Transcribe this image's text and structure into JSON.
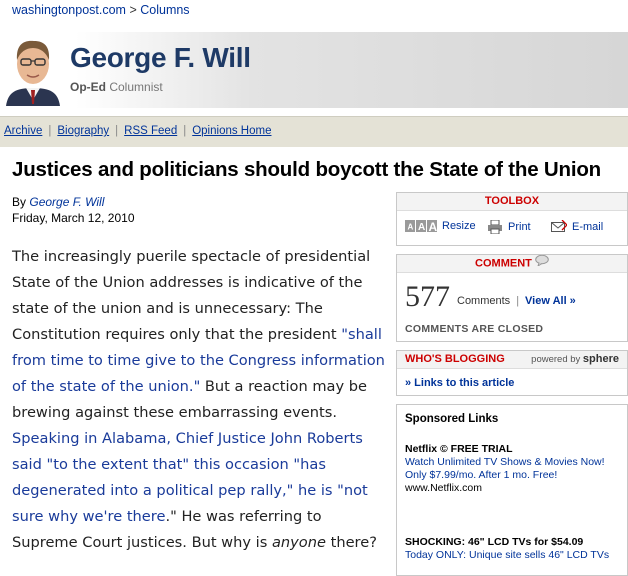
{
  "breadcrumb": {
    "site": "washingtonpost.com",
    "separator": ">",
    "section": "Columns"
  },
  "columnist": {
    "name": "George F. Will",
    "role_prefix": "Op-Ed",
    "role_suffix": "Columnist"
  },
  "nav": {
    "links": [
      "Archive",
      "Biography",
      "RSS Feed",
      "Opinions Home"
    ],
    "separator": "|"
  },
  "article": {
    "headline": "Justices and politicians should boycott the State of the Union",
    "by_prefix": "By",
    "author": "George F. Will",
    "date": "Friday, March 12, 2010",
    "p1_a": "The increasingly puerile spectacle of presidential State of the Union addresses is indicative of the state of the union and is unnecessary: The Constitution requires only that the president ",
    "p1_link1": "\"shall from time to time give to the Congress information of the state of the union.\"",
    "p1_b": " But a reaction may be brewing against these embarrassing events. ",
    "p1_link2": "Speaking in Alabama, Chief Justice John Roberts said \"to the extent that\" this occasion \"has degenerated into a political pep rally,\" he is \"not sure why we're there",
    "p1_c": ".\" He was referring to Supreme Court justices. But why is ",
    "p1_em": "anyone",
    "p1_d": " there?"
  },
  "toolbox": {
    "title": "TOOLBOX",
    "resize": "Resize",
    "print": "Print",
    "email": "E-mail"
  },
  "comments": {
    "title": "COMMENT",
    "count": "577",
    "label": "Comments",
    "separator": "|",
    "view_all": "View All »",
    "status": "COMMENTS ARE CLOSED"
  },
  "blogging": {
    "title": "WHO'S BLOGGING",
    "powered_by": "powered by",
    "brand": "sphere",
    "link": "» Links to this article"
  },
  "sponsored": {
    "title": "Sponsored Links",
    "ads": [
      {
        "title": "Netflix © FREE TRIAL",
        "desc": "Watch Unlimited TV Shows & Movies Now! Only $7.99/mo. After 1 mo. Free!",
        "url": "www.Netflix.com"
      },
      {
        "title": "SHOCKING: 46\" LCD TVs for $54.09",
        "desc": "Today ONLY: Unique site sells 46\" LCD TVs",
        "url": ""
      }
    ]
  },
  "colors": {
    "link": "#003399",
    "accent_red": "#cc0000",
    "name_blue": "#1e3a66",
    "nav_bg": "#e4e2d6"
  }
}
